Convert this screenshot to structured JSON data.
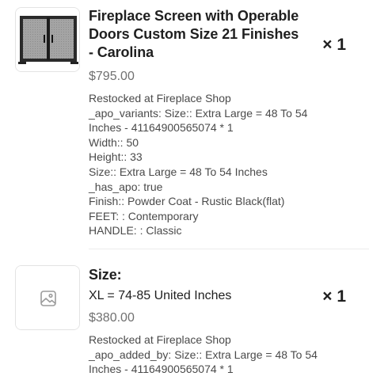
{
  "cart": {
    "items": [
      {
        "title_lines": [
          "Fireplace Screen with Operable",
          "Doors Custom Size 21 Finishes",
          "- Carolina"
        ],
        "price": "$795.00",
        "quantity": "× 1",
        "image_icon": "fireplace-screen-thumbnail",
        "properties": [
          "Restocked at Fireplace Shop",
          "_apo_variants: Size:: Extra Large = 48 To 54",
          "Inches - 41164900565074 * 1",
          "Width:: 50",
          "Height:: 33",
          "Size:: Extra Large = 48 To 54 Inches",
          "_has_apo: true",
          "Finish:: Powder Coat - Rustic Black(flat)",
          "FEET: : Contemporary",
          "HANDLE: : Classic"
        ]
      },
      {
        "title_lines": [
          "Size:"
        ],
        "variant": "XL = 74-85 United Inches",
        "price": "$380.00",
        "quantity": "× 1",
        "image_icon": "image-placeholder-icon",
        "properties": [
          "Restocked at Fireplace Shop",
          "_apo_added_by: Size:: Extra Large = 48 To 54",
          "Inches - 41164900565074 * 1"
        ]
      }
    ]
  },
  "colors": {
    "text": "#1f1f1f",
    "price": "#707070",
    "property": "#4a4a4a",
    "border": "#e3e3e3"
  }
}
